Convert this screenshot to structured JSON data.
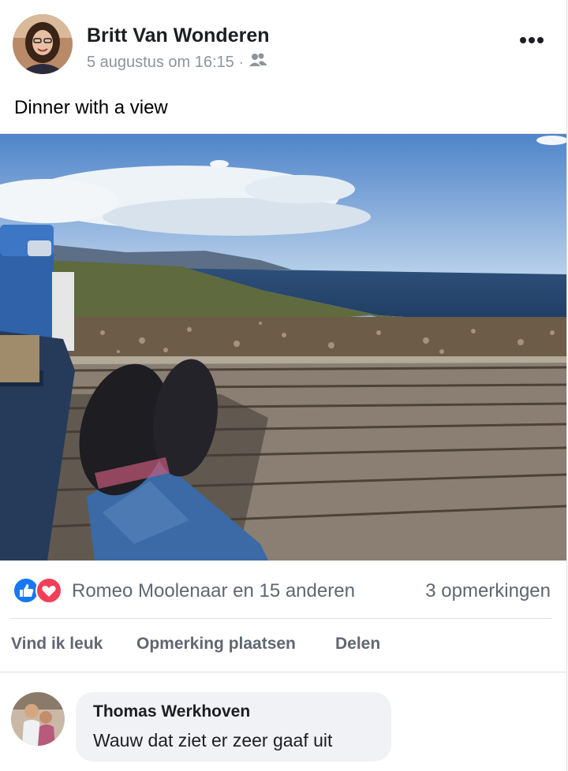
{
  "post": {
    "author": "Britt Van Wonderen",
    "timestamp": "5 augustus om 16:15",
    "separator": "·",
    "audience_icon": "friends-icon",
    "more_icon": "more-options-icon",
    "text": "Dinner with a view",
    "photo_subject": "feet-on-deck-ocean-view"
  },
  "reactions": {
    "icons": [
      "like-icon",
      "love-icon"
    ],
    "summary": "Romeo Moolenaar en 15 anderen",
    "comments_count": "3 opmerkingen"
  },
  "actions": {
    "like": "Vind ik leuk",
    "comment": "Opmerking plaatsen",
    "share": "Delen"
  },
  "comment": {
    "author": "Thomas Werkhoven",
    "text": "Wauw dat ziet er zeer gaaf uit"
  },
  "colors": {
    "like_blue": "#1877f2",
    "love_red": "#f33e58",
    "meta_gray": "#606770",
    "bubble_bg": "#f0f2f5"
  }
}
